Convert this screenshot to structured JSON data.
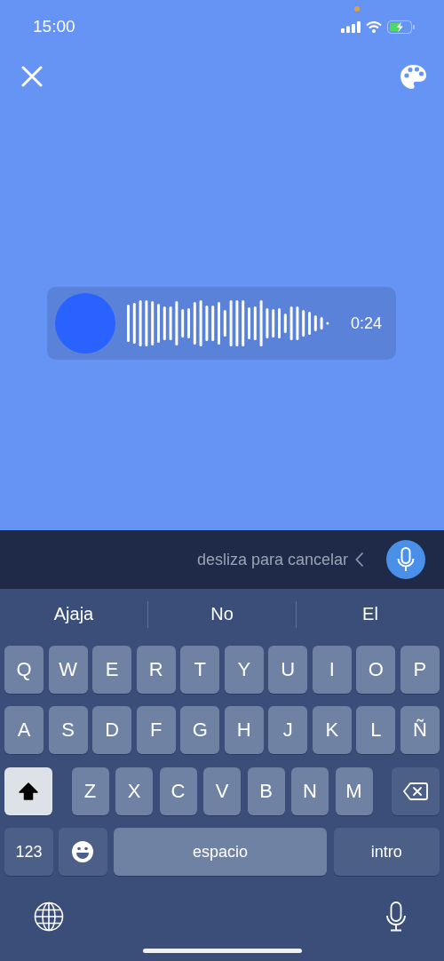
{
  "status_bar": {
    "time": "15:00"
  },
  "voice_message": {
    "duration": "0:24"
  },
  "recording_bar": {
    "hint": "desliza para cancelar"
  },
  "suggestions": [
    "Ajaja",
    "No",
    "El"
  ],
  "keyboard": {
    "top_letters": [
      "Q",
      "W",
      "E",
      "R",
      "T",
      "Y",
      "U",
      "I",
      "O",
      "P"
    ],
    "middle_letters": [
      "A",
      "S",
      "D",
      "F",
      "G",
      "H",
      "J",
      "K",
      "L",
      "Ñ"
    ],
    "bottom_letters": [
      "Z",
      "X",
      "C",
      "V",
      "B",
      "N",
      "M"
    ],
    "shift": {
      "on": true
    },
    "numbers_key": "123",
    "space_key": "espacio",
    "return_key": "intro"
  }
}
